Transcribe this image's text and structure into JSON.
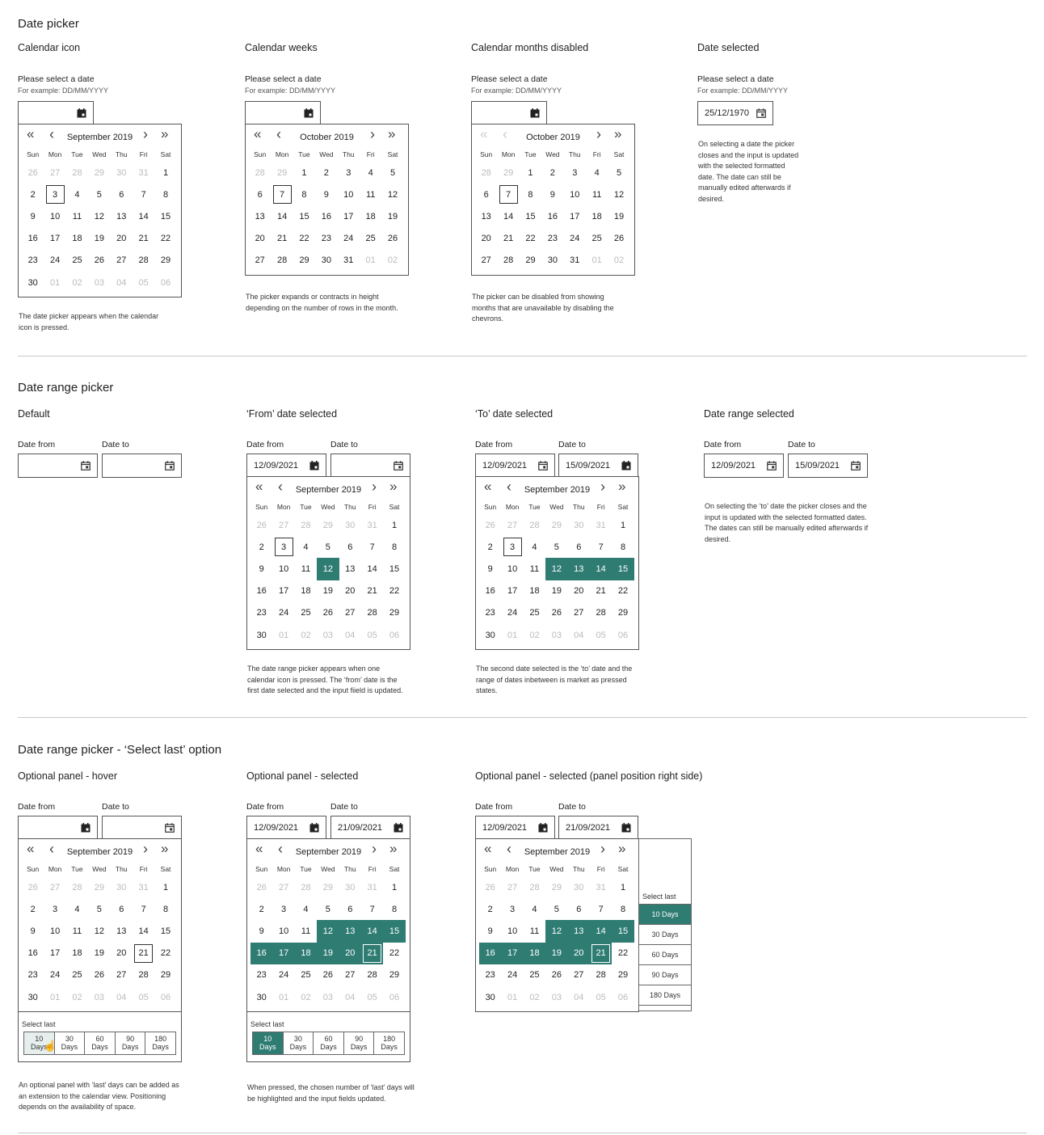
{
  "sections": {
    "date_picker": "Date picker",
    "date_range_picker": "Date range picker",
    "select_last": "Date range picker - ‘Select last’ option"
  },
  "labels": {
    "please_select": "Please select a date",
    "example": "For example: DD/MM/YYYY",
    "date_from": "Date from",
    "date_to": "Date to",
    "select_last": "Select last"
  },
  "weekdays": [
    "Sun",
    "Mon",
    "Tue",
    "Wed",
    "Thu",
    "Fri",
    "Sat"
  ],
  "options": [
    "10 Days",
    "30 Days",
    "60 Days",
    "90 Days",
    "180 Days"
  ],
  "accent": "#2f7c73",
  "icons": [
    "calendar-icon",
    "double-chevron-left-icon",
    "chevron-left-icon",
    "chevron-right-icon",
    "double-chevron-right-icon",
    "pointer-hand-icon"
  ],
  "calendars": {
    "sep2019": {
      "title": "September 2019",
      "weeks": [
        [
          "26",
          "27",
          "28",
          "29",
          "30",
          "31",
          "1"
        ],
        [
          "2",
          "3",
          "4",
          "5",
          "6",
          "7",
          "8"
        ],
        [
          "9",
          "10",
          "11",
          "12",
          "13",
          "14",
          "15"
        ],
        [
          "16",
          "17",
          "18",
          "19",
          "20",
          "21",
          "22"
        ],
        [
          "23",
          "24",
          "25",
          "26",
          "27",
          "28",
          "29"
        ],
        [
          "30",
          "01",
          "02",
          "03",
          "04",
          "05",
          "06"
        ]
      ],
      "first_week_other": 6,
      "last_week_current": 1
    },
    "oct2019": {
      "title": "October 2019",
      "weeks": [
        [
          "28",
          "29",
          "1",
          "2",
          "3",
          "4",
          "5"
        ],
        [
          "6",
          "7",
          "8",
          "9",
          "10",
          "11",
          "12"
        ],
        [
          "13",
          "14",
          "15",
          "16",
          "17",
          "18",
          "19"
        ],
        [
          "20",
          "21",
          "22",
          "23",
          "24",
          "25",
          "26"
        ],
        [
          "27",
          "28",
          "29",
          "30",
          "31",
          "01",
          "02"
        ]
      ],
      "first_week_other": 2,
      "last_week_current": 5
    }
  },
  "panels": {
    "p1": {
      "title": "Calendar icon",
      "calendar": "sep2019",
      "today": "3",
      "description": "The date picker appears when the calendar icon is pressed."
    },
    "p2": {
      "title": "Calendar weeks",
      "calendar": "oct2019",
      "today": "7",
      "description": "The picker expands or contracts in height depending on the number of rows in the month."
    },
    "p3": {
      "title": "Calendar months disabled",
      "calendar": "oct2019",
      "today": "7",
      "prev_disabled": true,
      "description": "The picker can be disabled from showing months that are unavailable by disabling the chevrons."
    },
    "p4": {
      "title": "Date selected",
      "value": "25/12/1970",
      "description": "On selecting a date the picker closes and the input is updated with the selected formatted date. The date can still be manually edited afterwards if desired."
    },
    "r1": {
      "title": "Default"
    },
    "r2": {
      "title": "‘From’ date selected",
      "from": "12/09/2021",
      "calendar": "sep2019",
      "today": "3",
      "selected": [
        "12"
      ],
      "description": "The date range picker appears when one calendar icon is pressed. The ‘from’ date is the first date selected and the input fiield is updated."
    },
    "r3": {
      "title": "‘To’ date selected",
      "from": "12/09/2021",
      "to": "15/09/2021",
      "calendar": "sep2019",
      "today": "3",
      "selected": [
        "12",
        "13",
        "14",
        "15"
      ],
      "description": "The second date selected is the ‘to’ date and the range of dates inbetween is market as pressed states."
    },
    "r4": {
      "title": "Date range selected",
      "from": "12/09/2021",
      "to": "15/09/2021",
      "description": "On selecting the ‘to’ date the picker closes and the input is updated with the selected formatted dates. The dates can still be manually edited afterwards if desired."
    },
    "s1": {
      "title": "Optional panel - hover",
      "calendar": "sep2019",
      "today": "21",
      "hover_option": 0,
      "description": "An optional panel with ‘last’ days can be added as an extension to the calendar view. Positioning depends on the availability of space."
    },
    "s2": {
      "title": "Optional panel - selected",
      "from": "12/09/2021",
      "to": "21/09/2021",
      "calendar": "sep2019",
      "today": "21",
      "selected": [
        "12",
        "13",
        "14",
        "15",
        "16",
        "17",
        "18",
        "19",
        "20",
        "21"
      ],
      "selected_option": 0,
      "description": "When pressed, the chosen number of ‘last’ days will be highlighted and the input fields updated."
    },
    "s3": {
      "title": "Optional panel - selected (panel position right side)",
      "from": "12/09/2021",
      "to": "21/09/2021",
      "calendar": "sep2019",
      "today": "21",
      "selected": [
        "12",
        "13",
        "14",
        "15",
        "16",
        "17",
        "18",
        "19",
        "20",
        "21"
      ],
      "selected_option": 0
    }
  }
}
